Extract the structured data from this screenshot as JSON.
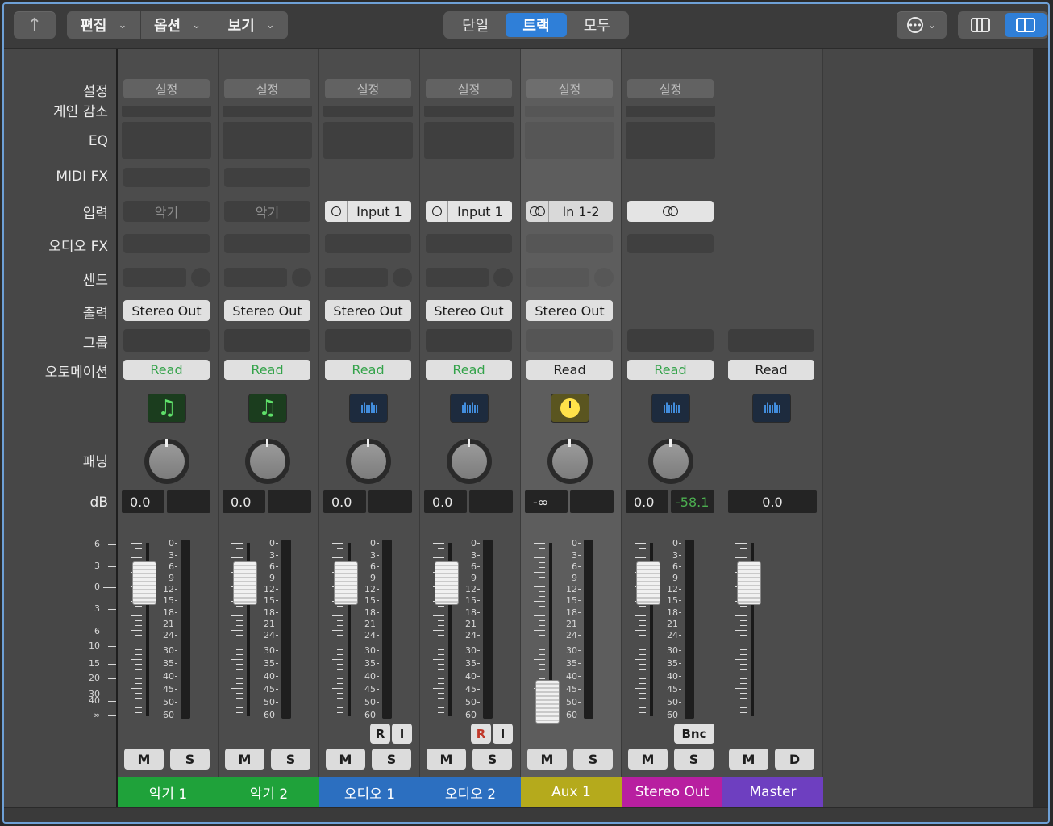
{
  "toolbar": {
    "up_icon": "up-arrow-icon",
    "menus": [
      "편집",
      "옵션",
      "보기"
    ],
    "segments": [
      "단일",
      "트랙",
      "모두"
    ],
    "active_segment": 1
  },
  "row_labels": {
    "setting": "설정",
    "gain": "게인 감소",
    "eq": "EQ",
    "midifx": "MIDI FX",
    "input": "입력",
    "audiofx": "오디오 FX",
    "send": "센드",
    "output": "출력",
    "group": "그룹",
    "automation": "오토메이션",
    "pan": "패닝",
    "db": "dB"
  },
  "left_scale": [
    "6",
    "3",
    "0",
    "3",
    "6",
    "10",
    "15",
    "20",
    "30",
    "40",
    "∞"
  ],
  "meter_scale": [
    "0",
    "3",
    "6",
    "9",
    "12",
    "15",
    "18",
    "21",
    "24",
    "30",
    "35",
    "40",
    "45",
    "50",
    "60"
  ],
  "strips": [
    {
      "name": "악기 1",
      "color": "#1fa23a",
      "setting": "설정",
      "input": "악기",
      "input_live": false,
      "output": "Stereo Out",
      "automation": "Read",
      "icon": "music-note-icon",
      "db_a": "0.0",
      "db_b": "",
      "bottom": [
        "M",
        "S"
      ],
      "fader_pos": 0.25
    },
    {
      "name": "악기 2",
      "color": "#1fa23a",
      "setting": "설정",
      "input": "악기",
      "input_live": false,
      "output": "Stereo Out",
      "automation": "Read",
      "icon": "music-note-icon",
      "db_a": "0.0",
      "db_b": "",
      "bottom": [
        "M",
        "S"
      ],
      "fader_pos": 0.25
    },
    {
      "name": "오디오 1",
      "color": "#2c6fc0",
      "setting": "설정",
      "input": "Input 1",
      "input_live": true,
      "input_icon": "mono",
      "output": "Stereo Out",
      "automation": "Read",
      "icon": "waveform-icon",
      "db_a": "0.0",
      "db_b": "",
      "extra": [
        "R",
        "I"
      ],
      "bottom": [
        "M",
        "S"
      ],
      "fader_pos": 0.25
    },
    {
      "name": "오디오 2",
      "color": "#2c6fc0",
      "setting": "설정",
      "input": "Input 1",
      "input_live": true,
      "input_icon": "mono",
      "output": "Stereo Out",
      "automation": "Read",
      "icon": "waveform-icon",
      "db_a": "0.0",
      "db_b": "",
      "extra": [
        "R",
        "I"
      ],
      "bottom": [
        "M",
        "S"
      ],
      "fader_pos": 0.25
    },
    {
      "name": "Aux 1",
      "color": "#b5aa1c",
      "setting": "설정",
      "input": "In 1-2",
      "input_live": true,
      "input_icon": "stereo",
      "output": "Stereo Out",
      "automation": "Read",
      "icon": "aux-icon",
      "db_a": "-∞",
      "db_b": "",
      "bottom": [
        "M",
        "S"
      ],
      "fader_pos": 1.0
    },
    {
      "name": "Stereo Out",
      "color": "#b81fa0",
      "setting": "설정",
      "input": "",
      "input_live": true,
      "input_icon": "stereo",
      "output": "",
      "automation": "Read",
      "icon": "waveform-icon",
      "db_a": "0.0",
      "db_b": "-58.1",
      "extra": [
        "Bnc"
      ],
      "bottom": [
        "M",
        "S"
      ],
      "fader_pos": 0.25
    },
    {
      "name": "Master",
      "color": "#6e3fc0",
      "setting": "",
      "input": "",
      "input_live": false,
      "output": "",
      "automation": "Read",
      "icon": "waveform-icon",
      "db_a": "",
      "db_b": "",
      "db_full": "0.0",
      "bottom": [
        "M",
        "D"
      ],
      "fader_pos": 0.25
    }
  ]
}
